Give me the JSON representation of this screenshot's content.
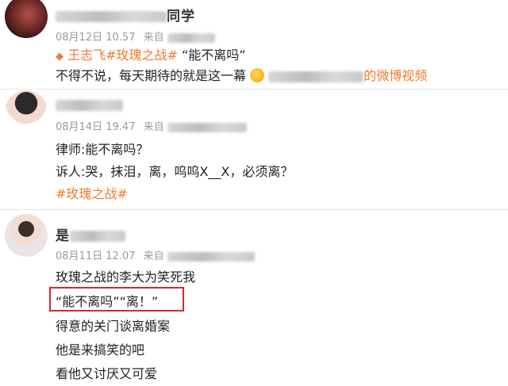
{
  "post1": {
    "username_visible": "同学",
    "time": "08月12日 10.57",
    "from_label": "来自",
    "tags": "王志飞#玫瑰之战#",
    "quote": "“能不离吗”",
    "body": "不得不说，每天期待的就是这一幕",
    "video_link": "的微博视频"
  },
  "post2": {
    "time": "08月14日 19.47",
    "from_label": "来自",
    "lines": [
      "律师:能不离吗？",
      "诉人:哭，抹泪，离，呜呜X__X，必须离？"
    ],
    "tag": "#玫瑰之战#"
  },
  "post3": {
    "username_visible": "是",
    "time": "08月11日 12.07",
    "from_label": "来自",
    "lines": [
      "玫瑰之战的李大为笑死我",
      "“能不离吗”“离！”",
      "得意的关门谈离婚案",
      "他是来搞笑的吧",
      "看他又讨厌又可爱"
    ]
  }
}
